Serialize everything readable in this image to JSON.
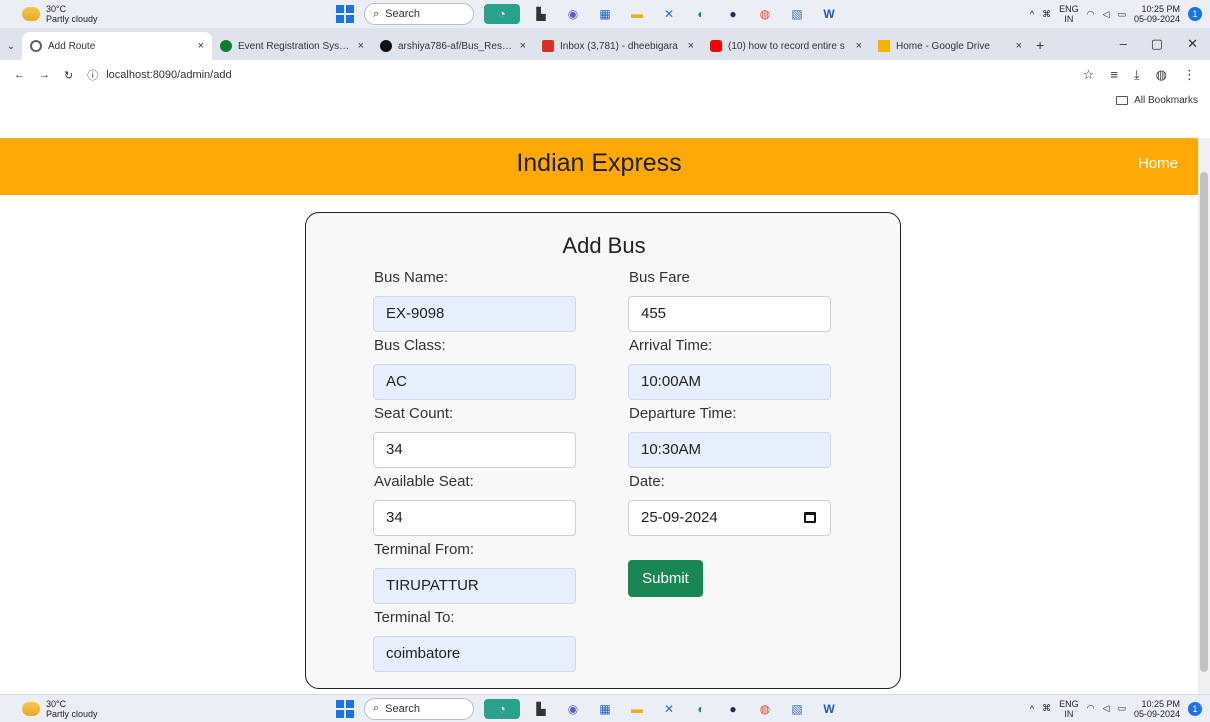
{
  "taskbar": {
    "weather_temp": "30°C",
    "weather_desc": "Partly cloudy",
    "search_placeholder": "Search",
    "lang_top": "ENG",
    "lang_bottom": "IN",
    "time": "10:25 PM",
    "date": "05-09-2024",
    "notifications": "1"
  },
  "tabs": [
    {
      "title": "Add Route",
      "close": "×",
      "icon_color": "#5f6368"
    },
    {
      "title": "Event Registration System",
      "close": "×",
      "icon_color": "#0a7d32"
    },
    {
      "title": "arshiya786-af/Bus_Reserva",
      "close": "×",
      "icon_color": "#111111"
    },
    {
      "title": "Inbox (3,781) - dheebigara",
      "close": "×",
      "icon_color": "#d93025"
    },
    {
      "title": "(10) how to record entire s",
      "close": "×",
      "icon_color": "#ff0000"
    },
    {
      "title": "Home - Google Drive",
      "close": "×",
      "icon_color": "#f4b400"
    }
  ],
  "new_tab": "+",
  "address": {
    "url": "localhost:8090/admin/add"
  },
  "bookmarks": {
    "label": "All Bookmarks"
  },
  "navbar": {
    "brand": "Indian Express",
    "home": "Home",
    "color": "#ffa906"
  },
  "form": {
    "title": "Add Bus",
    "bus_name_label": "Bus Name:",
    "bus_name": "EX-9098",
    "bus_class_label": "Bus Class:",
    "bus_class": "AC",
    "seat_count_label": "Seat Count:",
    "seat_count": "34",
    "available_seat_label": "Available Seat:",
    "available_seat": "34",
    "terminal_from_label": "Terminal From:",
    "terminal_from": "TIRUPATTUR",
    "terminal_to_label": "Terminal To:",
    "terminal_to": "coimbatore",
    "bus_fare_label": "Bus Fare",
    "bus_fare": "455",
    "arrival_label": "Arrival Time:",
    "arrival": "10:00AM",
    "departure_label": "Departure Time:",
    "departure": "10:30AM",
    "date_label": "Date:",
    "date": "25-09-2024",
    "submit": "Submit",
    "submit_color": "#198754"
  }
}
